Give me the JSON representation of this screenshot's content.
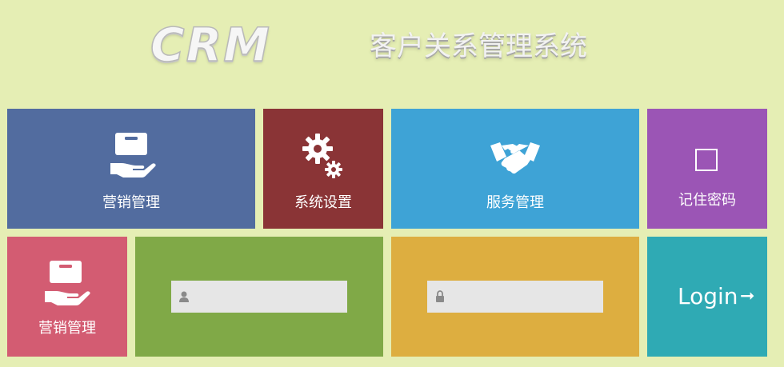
{
  "header": {
    "logo_text": "CRM",
    "subtitle": "客户关系管理系统"
  },
  "tiles": {
    "marketing_1": {
      "label": "营销管理",
      "color": "#526c9f",
      "icon": "gift-hand-icon"
    },
    "settings": {
      "label": "系统设置",
      "color": "#8a3436",
      "icon": "gears-icon"
    },
    "service": {
      "label": "服务管理",
      "color": "#3ea3d6",
      "icon": "handshake-icon"
    },
    "remember": {
      "label": "记住密码",
      "color": "#9b55b5",
      "icon": "checkbox-icon"
    },
    "marketing_2": {
      "label": "营销管理",
      "color": "#d35c72",
      "icon": "gift-hand-icon"
    },
    "username": {
      "color": "#80a947",
      "value": "",
      "placeholder": "",
      "icon": "user-icon"
    },
    "password": {
      "color": "#ddae40",
      "value": "",
      "placeholder": "",
      "icon": "lock-icon"
    },
    "login": {
      "label": "Login",
      "arrow": "➞",
      "color": "#2faab4",
      "icon": "arrow-right-icon"
    }
  }
}
